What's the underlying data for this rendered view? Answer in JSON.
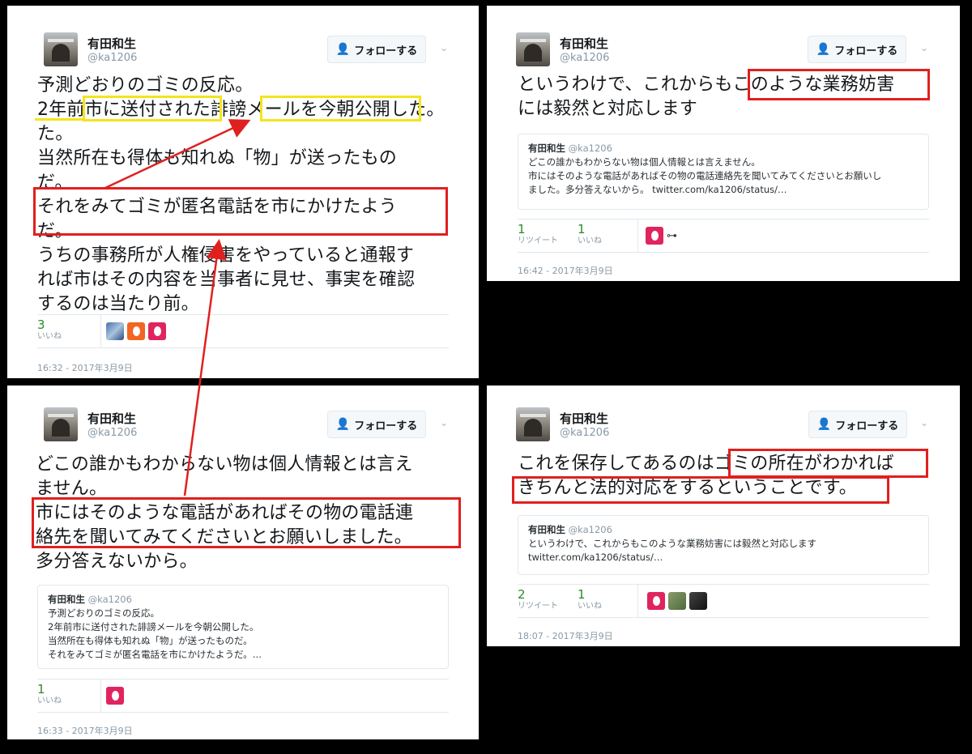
{
  "cards": [
    {
      "author": "有田和生",
      "handle": "@ka1206",
      "follow_label": "フォローする",
      "text_lines": [
        "予測どおりのゴミの反応。",
        "2年前市に送付された誹謗メールを今朝公開した。",
        "た。",
        "当然所在も得体も知れぬ「物」が送ったもの",
        "だ。",
        "それをみてゴミが匿名電話を市にかけたよう",
        "だ。",
        "うちの事務所が人権侵害をやっていると通報す",
        "れば市はその内容を当事者に見せ、事実を確認",
        "するのは当たり前。"
      ],
      "likes_count": "3",
      "likes_label": "いいね",
      "timestamp": "16:32 - 2017年3月9日"
    },
    {
      "author": "有田和生",
      "handle": "@ka1206",
      "follow_label": "フォローする",
      "text_lines": [
        "というわけで、これからもこのような業務妨害",
        "には毅然と対応します"
      ],
      "quote": {
        "author": "有田和生",
        "handle": "@ka1206",
        "lines": [
          "どこの誰かもわからない物は個人情報とは言えません。",
          "市にはそのような電話があればその物の電話連絡先を聞いてみてくださいとお願いし",
          "ました。多分答えないから。 twitter.com/ka1206/status/…"
        ]
      },
      "retweets_count": "1",
      "retweets_label": "リツイート",
      "likes_count": "1",
      "likes_label": "いいね",
      "timestamp": "16:42 - 2017年3月9日"
    },
    {
      "author": "有田和生",
      "handle": "@ka1206",
      "follow_label": "フォローする",
      "text_lines": [
        "どこの誰かもわからない物は個人情報とは言え",
        "ません。",
        "市にはそのような電話があればその物の電話連",
        "絡先を聞いてみてくださいとお願いしました。",
        "多分答えないから。"
      ],
      "quote": {
        "author": "有田和生",
        "handle": "@ka1206",
        "lines": [
          "予測どおりのゴミの反応。",
          "2年前市に送付された誹謗メールを今朝公開した。",
          "当然所在も得体も知れぬ「物」が送ったものだ。",
          "それをみてゴミが匿名電話を市にかけたようだ。…"
        ]
      },
      "likes_count": "1",
      "likes_label": "いいね",
      "timestamp": "16:33 - 2017年3月9日"
    },
    {
      "author": "有田和生",
      "handle": "@ka1206",
      "follow_label": "フォローする",
      "text_lines": [
        "これを保存してあるのはゴミの所在がわかれば",
        "きちんと法的対応をするということです。"
      ],
      "quote": {
        "author": "有田和生",
        "handle": "@ka1206",
        "lines": [
          "というわけで、これからもこのような業務妨害には毅然と対応します",
          "twitter.com/ka1206/status/…"
        ]
      },
      "retweets_count": "2",
      "retweets_label": "リツイート",
      "likes_count": "1",
      "likes_label": "いいね",
      "timestamp": "18:07 - 2017年3月9日"
    }
  ],
  "icons": {
    "follow": "person-plus-icon",
    "caret": "chevron-down-icon",
    "egg": "egg-avatar-icon",
    "key": "key-icon"
  },
  "colors": {
    "highlight_red": "#e0201e",
    "highlight_yellow": "#f4e41c",
    "count_green": "#2a8a2a",
    "twitter_blue": "#1da1f2"
  }
}
